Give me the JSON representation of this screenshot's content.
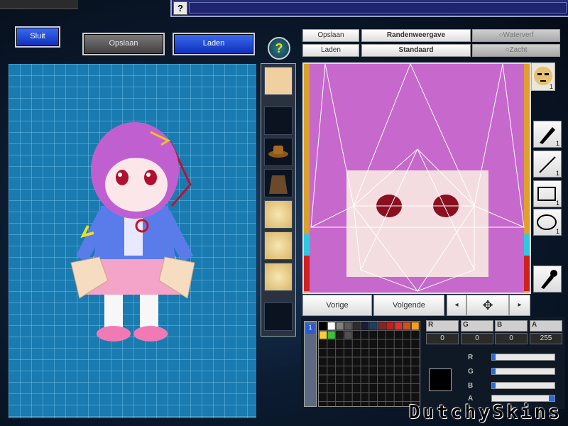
{
  "top_bar": {
    "help_glyph": "?"
  },
  "main_buttons": {
    "close": "Sluit",
    "save": "Opslaan",
    "load": "Laden",
    "help": "?"
  },
  "texture_toolbar": {
    "save": "Opslaan",
    "load": "Laden",
    "border_view": "Randenweergave",
    "standard": "Standaard",
    "watercolor": "Waterverf",
    "soft": "Zacht"
  },
  "part_strip": {
    "icons": [
      "character-portrait-icon",
      "empty-slot",
      "hat-icon",
      "coat-icon",
      "face-angry-icon",
      "face-plain-icon",
      "face-smile-icon",
      "empty-slot"
    ]
  },
  "face_preview_count": "1",
  "tools": [
    {
      "name": "pen-tool-icon",
      "count": "1"
    },
    {
      "name": "line-tool-icon",
      "count": "1"
    },
    {
      "name": "rectangle-tool-icon",
      "count": "1"
    },
    {
      "name": "ellipse-tool-icon",
      "count": "1"
    }
  ],
  "nav": {
    "previous": "Vorige",
    "next": "Volgende"
  },
  "color": {
    "labels": {
      "r": "R",
      "g": "G",
      "b": "B",
      "a": "A"
    },
    "values": {
      "r": "0",
      "g": "0",
      "b": "0",
      "a": "255"
    },
    "current": "#000000",
    "slider_levels": {
      "r": 0.0,
      "g": 0.0,
      "b": 0.0,
      "a": 1.0
    },
    "palette": [
      "#000000",
      "#ffffff",
      "#808080",
      "#5a5a5a",
      "#2d2d2d",
      "#1a1a3a",
      "#1f3f5f",
      "#7a2a2a",
      "#c02020",
      "#e03030",
      "#d05020",
      "#f0a020",
      "#f8d030",
      "#40c040",
      "#1a1a1a",
      "#505050"
    ]
  },
  "layer_count": "1",
  "brand": "DutchySkins"
}
